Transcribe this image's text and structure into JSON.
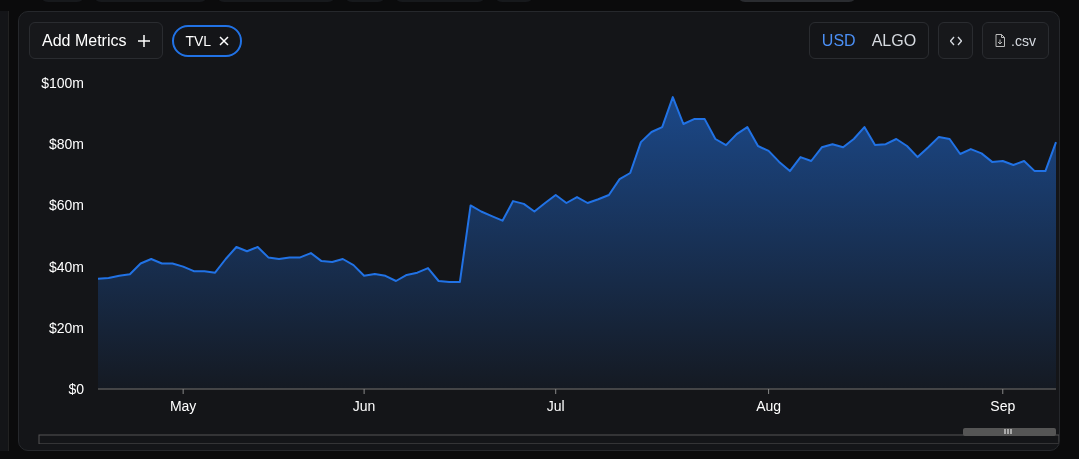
{
  "toolbar": {
    "add_metrics": {
      "label": "Add Metrics"
    },
    "metric_tags": [
      {
        "label": "TVL"
      }
    ],
    "currencies": [
      {
        "label": "USD",
        "selected": true
      },
      {
        "label": "ALGO",
        "selected": false
      }
    ],
    "csv_button": {
      "label": ".csv"
    }
  },
  "chart": {
    "chart_data": {
      "type": "area",
      "ylim": [
        0,
        100
      ],
      "yticks": [
        {
          "value": 0,
          "label": "$0"
        },
        {
          "value": 20,
          "label": "$20m"
        },
        {
          "value": 40,
          "label": "$40m"
        },
        {
          "value": 60,
          "label": "$60m"
        },
        {
          "value": 80,
          "label": "$80m"
        },
        {
          "value": 100,
          "label": "$100m"
        }
      ],
      "categories": [
        null,
        null,
        null,
        null,
        null,
        null,
        null,
        null,
        "May",
        null,
        null,
        null,
        null,
        null,
        null,
        null,
        null,
        null,
        null,
        null,
        null,
        null,
        null,
        null,
        null,
        "Jun",
        null,
        null,
        null,
        null,
        null,
        null,
        null,
        null,
        null,
        null,
        null,
        null,
        null,
        null,
        null,
        null,
        null,
        "Jul",
        null,
        null,
        null,
        null,
        null,
        null,
        null,
        null,
        null,
        null,
        null,
        null,
        null,
        null,
        null,
        null,
        null,
        null,
        null,
        "Aug",
        null,
        null,
        null,
        null,
        null,
        null,
        null,
        null,
        null,
        null,
        null,
        null,
        null,
        null,
        null,
        null,
        null,
        null,
        null,
        null,
        null,
        "Sep",
        null,
        null,
        null,
        null,
        null
      ],
      "series": [
        {
          "color": "#2172e5",
          "values": [
            36,
            36.3,
            37,
            37.5,
            41,
            42.5,
            41,
            41,
            40,
            38.5,
            38.5,
            38,
            42.5,
            46.4,
            45,
            46.4,
            43,
            42.5,
            43,
            43,
            44.4,
            41.8,
            41.5,
            42.5,
            40.5,
            37,
            37.6,
            37,
            35.3,
            37.3,
            38,
            39.5,
            35.3,
            35,
            35,
            60,
            58,
            56.5,
            55,
            61.4,
            60.5,
            58,
            60.8,
            63.4,
            60.8,
            62.7,
            60.8,
            62,
            63.4,
            68.6,
            70.6,
            80.7,
            84,
            85.6,
            95.4,
            86.6,
            88.2,
            88.2,
            81.7,
            79.7,
            83.3,
            85.6,
            79.4,
            77.8,
            74.2,
            71.2,
            75.8,
            74.5,
            79,
            80,
            79,
            81.7,
            85.6,
            79.7,
            80,
            81.7,
            79.4,
            75.8,
            79,
            82.4,
            81.7,
            76.8,
            78.4,
            77,
            74.2,
            74.5,
            73.2,
            74.5,
            71.2,
            71.2,
            80.7
          ]
        }
      ]
    }
  }
}
